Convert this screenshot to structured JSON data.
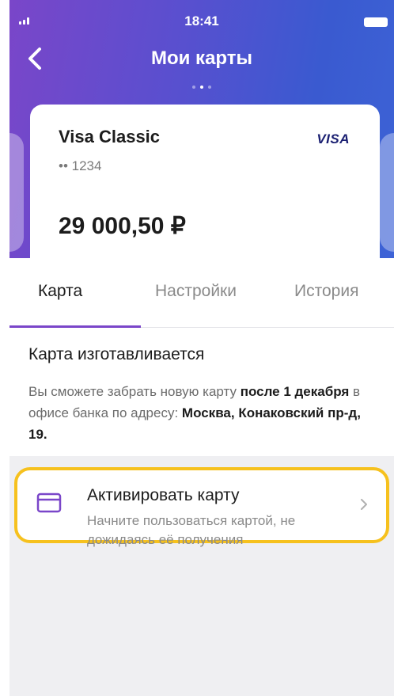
{
  "status_bar": {
    "time": "18:41"
  },
  "header": {
    "title": "Мои карты"
  },
  "card": {
    "name": "Visa Classic",
    "brand": "VISA",
    "number": "•• 1234",
    "balance": "29 000,50 ₽"
  },
  "tabs": [
    {
      "label": "Карта",
      "active": true
    },
    {
      "label": "Настройки",
      "active": false
    },
    {
      "label": "История",
      "active": false
    }
  ],
  "info": {
    "title": "Карта изготавливается",
    "text_part1": "Вы сможете забрать новую карту ",
    "text_bold1": "после 1 декабря",
    "text_part2": " в офисе банка по адресу: ",
    "text_bold2": "Москва, Конаковский пр-д, 19."
  },
  "activate": {
    "title": "Активировать карту",
    "subtitle": "Начните пользоваться картой, не дожидаясь её получения",
    "icon": "card-icon"
  },
  "colors": {
    "accent": "#7a46c9",
    "highlight": "#f6c11e",
    "gradient_start": "#7a46c9",
    "gradient_end": "#3d63d6"
  }
}
